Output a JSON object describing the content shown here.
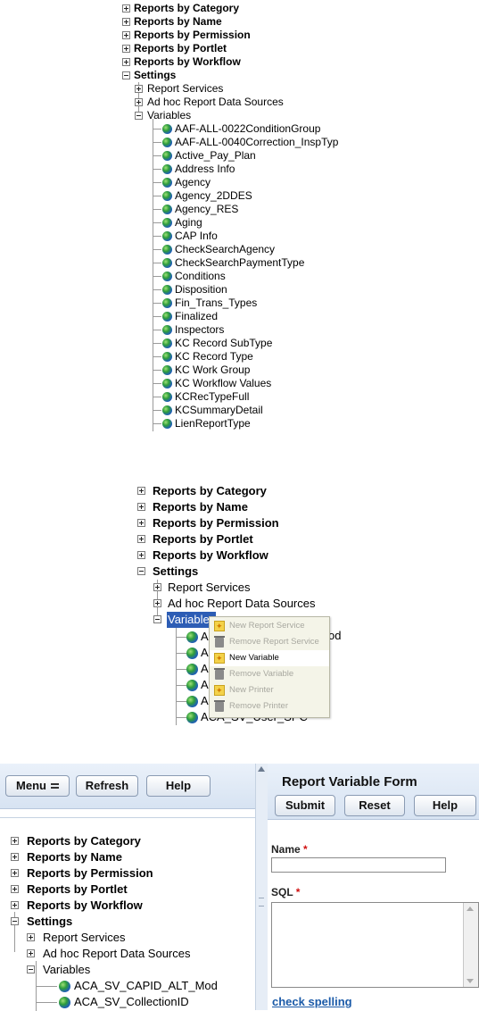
{
  "panel1": {
    "top_items": [
      "Reports by Category",
      "Reports by Name",
      "Reports by Permission",
      "Reports by Portlet",
      "Reports by Workflow"
    ],
    "settings": "Settings",
    "sub_items": [
      "Report Services",
      "Ad hoc Report Data Sources"
    ],
    "variables": "Variables",
    "variable_items": [
      "AAF-ALL-0022ConditionGroup",
      "AAF-ALL-0040Correction_InspTyp",
      "Active_Pay_Plan",
      "Address Info",
      "Agency",
      "Agency_2DDES",
      "Agency_RES",
      "Aging",
      "CAP Info",
      "CheckSearchAgency",
      "CheckSearchPaymentType",
      "Conditions",
      "Disposition",
      "Fin_Trans_Types",
      "Finalized",
      "Inspectors",
      "KC Record SubType",
      "KC Record Type",
      "KC Work Group",
      "KC Workflow Values",
      "KCRecTypeFull",
      "KCSummaryDetail",
      "LienReportType"
    ]
  },
  "panel2": {
    "top_items": [
      "Reports by Category",
      "Reports by Name",
      "Reports by Permission",
      "Reports by Portlet",
      "Reports by Workflow"
    ],
    "settings": "Settings",
    "sub_items": [
      "Report Services",
      "Ad hoc Report Data Sources"
    ],
    "variables": "Variables",
    "partial_items": [
      "AC",
      "AC",
      "AC",
      "AC",
      "AC",
      "ACA_SV_User_SPC"
    ],
    "partial_trailing": "od",
    "context_menu": [
      {
        "label": "New Report Service",
        "state": "disabled",
        "icon": "new-service-icon"
      },
      {
        "label": "Remove Report Service",
        "state": "disabled",
        "icon": "trash-icon"
      },
      {
        "label": "New Variable",
        "state": "active",
        "icon": "new-variable-icon"
      },
      {
        "label": "Remove Variable",
        "state": "disabled",
        "icon": "trash-icon"
      },
      {
        "label": "New Printer",
        "state": "disabled",
        "icon": "new-printer-icon"
      },
      {
        "label": "Remove Printer",
        "state": "disabled",
        "icon": "trash-icon"
      }
    ]
  },
  "panel3": {
    "toolbar": {
      "menu": "Menu",
      "refresh": "Refresh",
      "help": "Help"
    },
    "tree": {
      "top_items": [
        "Reports by Category",
        "Reports by Name",
        "Reports by Permission",
        "Reports by Portlet",
        "Reports by Workflow"
      ],
      "settings": "Settings",
      "sub_items": [
        "Report Services",
        "Ad hoc Report Data Sources"
      ],
      "variables": "Variables",
      "variable_items": [
        "ACA_SV_CAPID_ALT_Mod",
        "ACA_SV_CollectionID"
      ]
    },
    "form": {
      "title": "Report Variable Form",
      "submit": "Submit",
      "reset": "Reset",
      "help": "Help",
      "name_label": "Name",
      "sql_label": "SQL",
      "required_mark": "*",
      "name_value": "",
      "sql_value": "",
      "check_spelling": "check spelling"
    }
  }
}
